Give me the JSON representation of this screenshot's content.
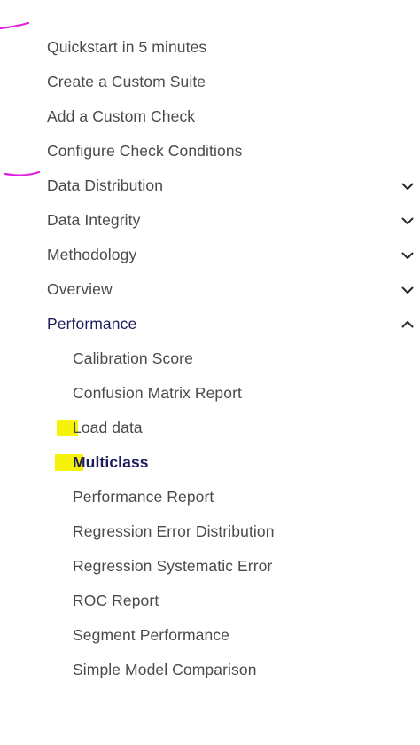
{
  "nav": {
    "items": [
      {
        "label": "Quickstart in 5 minutes"
      },
      {
        "label": "Create a Custom Suite"
      },
      {
        "label": "Add a Custom Check"
      },
      {
        "label": "Configure Check Conditions"
      },
      {
        "label": "Data Distribution",
        "icon": "chevron-down-icon"
      },
      {
        "label": "Data Integrity",
        "icon": "chevron-down-icon"
      },
      {
        "label": "Methodology",
        "icon": "chevron-down-icon"
      },
      {
        "label": "Overview",
        "icon": "chevron-down-icon"
      },
      {
        "label": "Performance",
        "icon": "chevron-up-icon",
        "expanded": true
      },
      {
        "label": "Calibration Score"
      },
      {
        "label": "Confusion Matrix Report"
      },
      {
        "label": "Load data"
      },
      {
        "label": "Multiclass",
        "active": true
      },
      {
        "label": "Performance Report"
      },
      {
        "label": "Regression Error Distribution"
      },
      {
        "label": "Regression Systematic Error"
      },
      {
        "label": "ROC Report"
      },
      {
        "label": "Segment Performance"
      },
      {
        "label": "Simple Model Comparison"
      }
    ]
  },
  "colors": {
    "text": "#4a4a4a",
    "active_text": "#1f1d5c",
    "highlight": "#f7f20a",
    "annotation": "#e020e0"
  }
}
